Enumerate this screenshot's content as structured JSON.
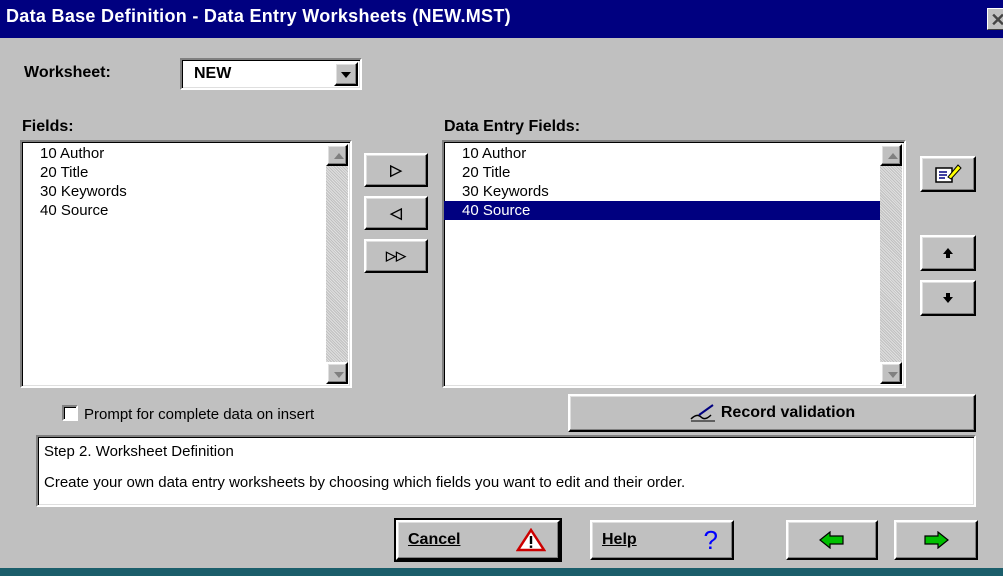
{
  "window": {
    "title": "Data Base Definition - Data Entry Worksheets (NEW.MST)",
    "close_glyph": "✕"
  },
  "worksheet": {
    "label": "Worksheet:",
    "value": "NEW"
  },
  "fields": {
    "label": "Fields:",
    "items": [
      "10 Author",
      "20 Title",
      "30 Keywords",
      "40 Source"
    ]
  },
  "data_entry_fields": {
    "label": "Data Entry Fields:",
    "items": [
      "10 Author",
      "20 Title",
      "30 Keywords",
      "40 Source"
    ],
    "selected_index": 3
  },
  "transfer_buttons": {
    "add": "▷",
    "remove": "◁",
    "add_all": "▷▷"
  },
  "prompt_checkbox": {
    "label": "Prompt for complete data on insert",
    "checked": false
  },
  "record_validation": {
    "label": "Record validation"
  },
  "description": {
    "step": "Step 2. Worksheet Definition",
    "text": "Create your own data entry worksheets by choosing which fields you want to edit and their order."
  },
  "buttons": {
    "cancel": "Cancel",
    "help": "Help",
    "help_glyph": "?"
  },
  "colors": {
    "title_bar": "#000080",
    "selection": "#000080",
    "face": "#c0c0c0",
    "arrow_green": "#00c000",
    "help_blue": "#0000ff",
    "warning_red": "#cc0000"
  }
}
